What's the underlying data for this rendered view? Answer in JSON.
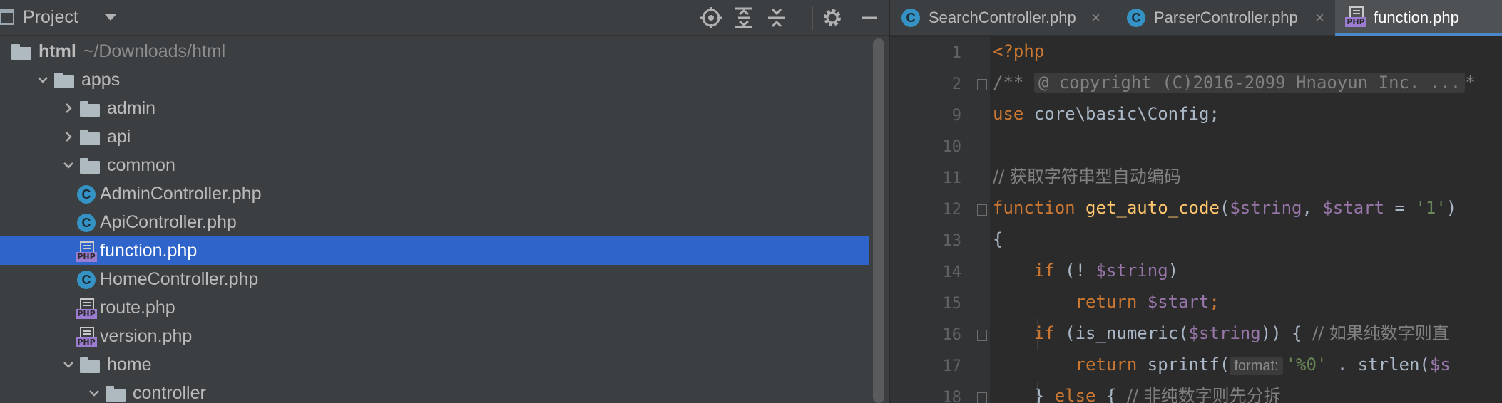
{
  "project_panel": {
    "title": "Project",
    "tree": [
      {
        "type": "folder",
        "expanded": true,
        "depth": 0,
        "name": "html",
        "path": "~/Downloads/html",
        "bold": true
      },
      {
        "type": "folder",
        "expanded": true,
        "depth": 1,
        "name": "apps"
      },
      {
        "type": "folder",
        "expanded": false,
        "depth": 2,
        "name": "admin"
      },
      {
        "type": "folder",
        "expanded": false,
        "depth": 2,
        "name": "api"
      },
      {
        "type": "folder",
        "expanded": true,
        "depth": 2,
        "name": "common"
      },
      {
        "type": "class",
        "depth": 3,
        "name": "AdminController.php"
      },
      {
        "type": "class",
        "depth": 3,
        "name": "ApiController.php"
      },
      {
        "type": "php",
        "depth": 3,
        "name": "function.php",
        "selected": true
      },
      {
        "type": "class",
        "depth": 3,
        "name": "HomeController.php"
      },
      {
        "type": "php",
        "depth": 3,
        "name": "route.php"
      },
      {
        "type": "php",
        "depth": 3,
        "name": "version.php"
      },
      {
        "type": "folder",
        "expanded": true,
        "depth": 2,
        "name": "home"
      },
      {
        "type": "folder",
        "expanded": true,
        "depth": 3,
        "name": "controller"
      }
    ]
  },
  "tabs": [
    {
      "label": "SearchController.php",
      "icon": "class-icon",
      "active": false
    },
    {
      "label": "ParserController.php",
      "icon": "class-icon",
      "active": false
    },
    {
      "label": "function.php",
      "icon": "php-file-icon",
      "active": true
    }
  ],
  "icons": {
    "class_letter": "C",
    "php_tag": "PHP",
    "close": "×"
  },
  "editor": {
    "line_numbers": [
      "1",
      "2",
      "9",
      "10",
      "11",
      "12",
      "13",
      "14",
      "15",
      "16",
      "17",
      "18"
    ],
    "lines": {
      "l1": "<?php",
      "l2_prefix": "/**",
      "l2_folded": "@ copyright (C)2016-2099 Hnaoyun Inc. ...",
      "l2_suffix": "*",
      "l9_kw": "use",
      "l9_rest": " core\\basic\\Config;",
      "l11": "// 获取字符串型自动编码",
      "l12_kw": "function",
      "l12_fn": "get_auto_code",
      "l12_p1": "(",
      "l12_var1": "$string",
      "l12_comma": ", ",
      "l12_var2": "$start",
      "l12_eq": " = ",
      "l12_str": "'1'",
      "l12_end": ")",
      "l13": "{",
      "l14_kw": "if",
      "l14_a": " (! ",
      "l14_var": "$string",
      "l14_b": ")",
      "l15_kw": "return",
      "l15_var": "$start",
      "l15_semi": ";",
      "l16_kw": "if",
      "l16_a": " (is_numeric(",
      "l16_var": "$string",
      "l16_b": ")) { ",
      "l16_cm": "// 如果纯数字则直",
      "l17_kw": "return",
      "l17_a": " sprintf(",
      "l17_hint": "format:",
      "l17_str": "'%0'",
      "l17_b": " . strlen(",
      "l17_var": "$s",
      "l18_a": "} ",
      "l18_kw": "else",
      "l18_b": " { ",
      "l18_cm": "// 非纯数字则先分拆"
    }
  }
}
